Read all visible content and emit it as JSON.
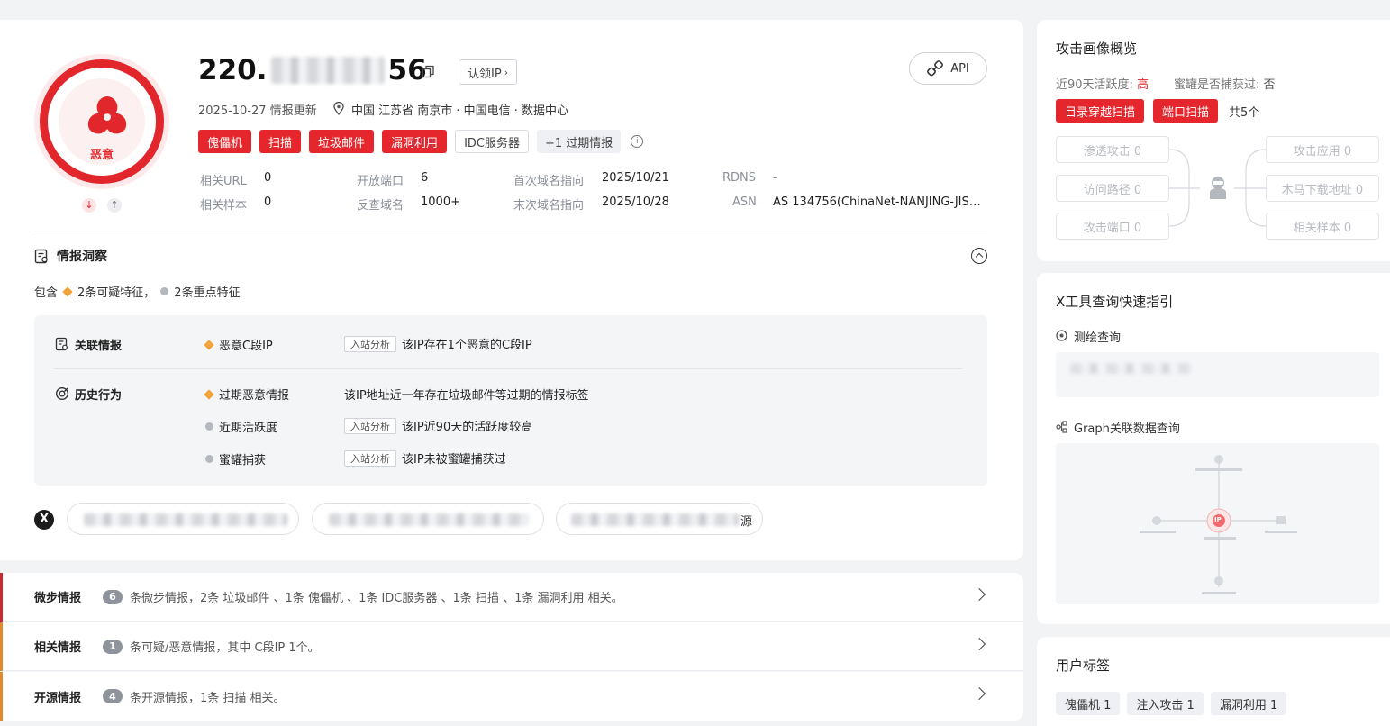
{
  "ip": {
    "prefix": "220.",
    "suffix": "56",
    "claim_label": "认领IP",
    "api_label": "API",
    "update_date": "2025-10-27",
    "update_label": "情报更新",
    "location": "中国 江苏省 南京市 · 中国电信 · 数据中心",
    "verdict": "恶意"
  },
  "tags": [
    {
      "label": "傀儡机",
      "style": "red"
    },
    {
      "label": "扫描",
      "style": "red"
    },
    {
      "label": "垃圾邮件",
      "style": "red"
    },
    {
      "label": "漏洞利用",
      "style": "red"
    },
    {
      "label": "IDC服务器",
      "style": "outline"
    },
    {
      "label": "+1 过期情报",
      "style": "gray"
    }
  ],
  "stats": {
    "related_url": {
      "label": "相关URL",
      "value": "0"
    },
    "related_sample": {
      "label": "相关样本",
      "value": "0"
    },
    "open_ports": {
      "label": "开放端口",
      "value": "6"
    },
    "reverse_domain": {
      "label": "反查域名",
      "value": "1000+"
    },
    "first_domain": {
      "label": "首次域名指向",
      "value": "2025/10/21"
    },
    "last_domain": {
      "label": "末次域名指向",
      "value": "2025/10/28"
    },
    "rdns": {
      "label": "RDNS",
      "value": "-"
    },
    "asn": {
      "label": "ASN",
      "value": "AS 134756(ChinaNet-NANJING-JIS…"
    }
  },
  "insight": {
    "title": "情报洞察",
    "summary_prefix": "包含",
    "summary_suspicious": "2条可疑特征，",
    "summary_key": "2条重点特征",
    "sections": [
      {
        "title": "关联情报",
        "items": [
          {
            "marker": "diamond",
            "name": "恶意C段IP",
            "tag": "入站分析",
            "desc": "该IP存在1个恶意的C段IP"
          }
        ]
      },
      {
        "title": "历史行为",
        "items": [
          {
            "marker": "diamond",
            "name": "过期恶意情报",
            "tag": "",
            "desc": "该IP地址近一年存在垃圾邮件等过期的情报标签"
          },
          {
            "marker": "dot",
            "name": "近期活跃度",
            "tag": "入站分析",
            "desc": "该IP近90天的活跃度较高"
          },
          {
            "marker": "dot",
            "name": "蜜罐捕获",
            "tag": "入站分析",
            "desc": "该IP未被蜜罐捕获过"
          }
        ]
      }
    ],
    "source_tail": "源"
  },
  "rows": [
    {
      "title": "微步情报",
      "count": "6",
      "desc": "条微步情报，2条 垃圾邮件 、1条 傀儡机 、1条 IDC服务器 、1条 扫描 、1条 漏洞利用 相关。",
      "accent": "#c8282e"
    },
    {
      "title": "相关情报",
      "count": "1",
      "desc": "条可疑/恶意情报，其中 C段IP 1个。",
      "accent": "#e08a2c"
    },
    {
      "title": "开源情报",
      "count": "4",
      "desc": "条开源情报，1条 扫描 相关。",
      "accent": "#e08a2c"
    }
  ],
  "portrait": {
    "title": "攻击画像概览",
    "activity_label": "近90天活跃度:",
    "activity_value": "高",
    "honeypot_label": "蜜罐是否捕获过:",
    "honeypot_value": "否",
    "tags": [
      "目录穿越扫描",
      "端口扫描"
    ],
    "tags_total": "共5个",
    "left_boxes": [
      "渗透攻击 0",
      "访问路径 0",
      "攻击端口 0"
    ],
    "right_boxes": [
      "攻击应用 0",
      "木马下载地址 0",
      "相关样本 0"
    ]
  },
  "xtools": {
    "title": "X工具查询快速指引",
    "survey_label": "测绘查询",
    "graph_label": "Graph关联数据查询",
    "graph_center": "IP"
  },
  "user_tags": {
    "title": "用户标签",
    "items": [
      "傀儡机 1",
      "注入攻击 1",
      "漏洞利用 1"
    ]
  },
  "colors": {
    "red": "#e5272d",
    "orange": "#f2a33a"
  }
}
